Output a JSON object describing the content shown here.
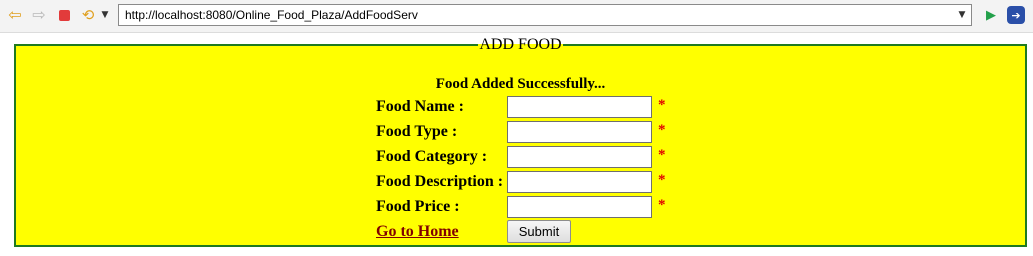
{
  "browser": {
    "url": "http://localhost:8080/Online_Food_Plaza/AddFoodServ",
    "icons": {
      "back": "arrow-left-icon",
      "forward": "arrow-right-icon",
      "stop": "stop-icon",
      "refresh": "refresh-icon",
      "menu": "chevron-down-icon",
      "url_dropdown": "chevron-down-icon",
      "go": "play-icon",
      "extension": "extension-icon"
    }
  },
  "form": {
    "legend": "ADD FOOD",
    "success_message": "Food Added Successfully...",
    "required_mark": "*",
    "fields": [
      {
        "label": "Food Name :",
        "value": ""
      },
      {
        "label": "Food Type :",
        "value": ""
      },
      {
        "label": "Food Category :",
        "value": ""
      },
      {
        "label": "Food Description :",
        "value": ""
      },
      {
        "label": "Food Price :",
        "value": ""
      }
    ],
    "home_link": "Go to Home",
    "submit_label": "Submit"
  },
  "colors": {
    "panel_background": "#ffff00",
    "panel_border": "#1f7a1f",
    "required": "#e00000",
    "link": "#800000"
  }
}
